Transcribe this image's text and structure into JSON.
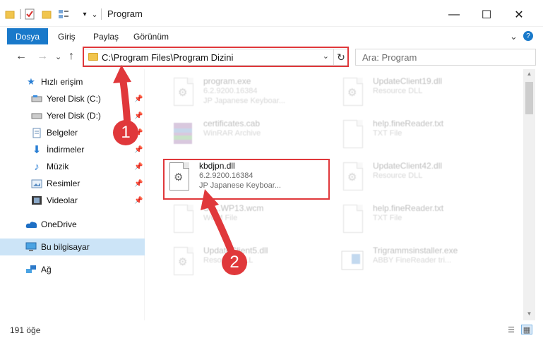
{
  "window": {
    "title": "Program",
    "minimize": "—",
    "maximize": "☐",
    "close": "✕"
  },
  "quick_access_toolbar": {
    "folder_icon": "folder-icon",
    "properties_icon": "properties-icon",
    "newfolder_icon": "new-folder-icon",
    "customize": "▾"
  },
  "ribbon": {
    "tabs": [
      {
        "label": "Dosya"
      },
      {
        "label": "Giriş"
      },
      {
        "label": "Paylaş"
      },
      {
        "label": "Görünüm"
      }
    ],
    "expand": "⌄",
    "help": "?"
  },
  "navigation": {
    "back": "←",
    "forward": "→",
    "recent": "⌄",
    "up": "↑"
  },
  "address": {
    "path": "C:\\Program Files\\Program Dizini",
    "dropdown": "⌄",
    "refresh": "↻"
  },
  "search": {
    "placeholder": "Ara: Program"
  },
  "sidebar": {
    "items": [
      {
        "label": "Hızlı erişim",
        "icon": "star-icon"
      },
      {
        "label": "Yerel Disk (C:)",
        "icon": "drive-icon"
      },
      {
        "label": "Yerel Disk (D:)",
        "icon": "drive-icon"
      },
      {
        "label": "Belgeler",
        "icon": "documents-icon"
      },
      {
        "label": "İndirmeler",
        "icon": "downloads-icon"
      },
      {
        "label": "Müzik",
        "icon": "music-icon"
      },
      {
        "label": "Resimler",
        "icon": "pictures-icon"
      },
      {
        "label": "Videolar",
        "icon": "videos-icon"
      },
      {
        "label": "OneDrive",
        "icon": "cloud-icon"
      },
      {
        "label": "Bu bilgisayar",
        "icon": "computer-icon"
      },
      {
        "label": "Ağ",
        "icon": "network-icon"
      }
    ]
  },
  "files": [
    {
      "name": "program.exe",
      "line1": "6.2.9200.16384",
      "line2": "JP Japanese Keyboar..."
    },
    {
      "name": "UpdateClient19.dll",
      "line1": "Resource DLL",
      "line2": ""
    },
    {
      "name": "certificates.cab",
      "line1": "WinRAR Archive",
      "line2": ""
    },
    {
      "name": "help.fineReader.txt",
      "line1": "TXT File",
      "line2": ""
    },
    {
      "name": "kbdjpn.dll",
      "line1": "6.2.9200.16384",
      "line2": "JP Japanese Keyboar..."
    },
    {
      "name": "UpdateClient42.dll",
      "line1": "Resource DLL",
      "line2": ""
    },
    {
      "name": "Sh...WP13.wcm",
      "line1": "WCM File",
      "line2": ""
    },
    {
      "name": "help.fineReader.txt",
      "line1": "TXT File",
      "line2": ""
    },
    {
      "name": "UpdateClient5.dll",
      "line1": "Resource DLL",
      "line2": ""
    },
    {
      "name": "Trigrammsinstaller.exe",
      "line1": "ABBY FineReader tri...",
      "line2": ""
    }
  ],
  "callouts": {
    "one": "1",
    "two": "2"
  },
  "status": {
    "count": "191 öğe"
  },
  "colors": {
    "accent": "#1979ca",
    "highlight": "#e0383b",
    "selected": "#cce4f7"
  }
}
